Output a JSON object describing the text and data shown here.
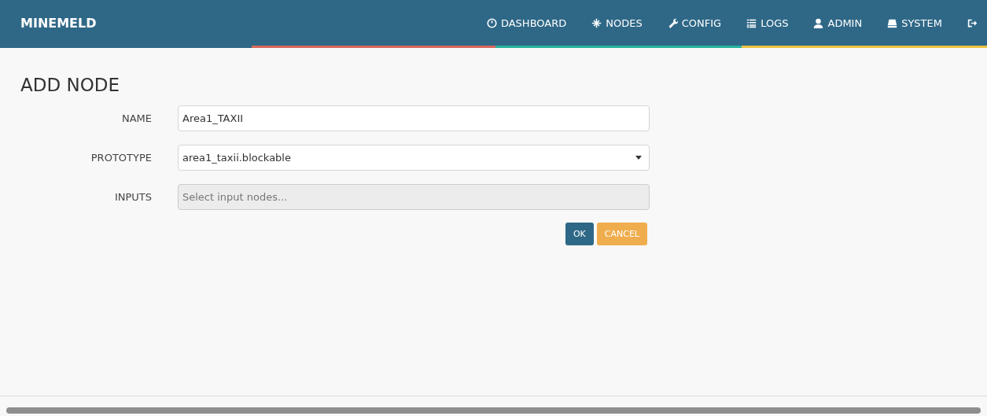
{
  "brand": "MINEMELD",
  "nav": [
    {
      "label": "DASHBOARD",
      "kind": "link"
    },
    {
      "label": "NODES",
      "kind": "link"
    },
    {
      "label": "CONFIG",
      "kind": "link"
    },
    {
      "label": "LOGS",
      "kind": "link"
    },
    {
      "label": "ADMIN",
      "kind": "link"
    },
    {
      "label": "SYSTEM",
      "kind": "link"
    },
    {
      "kind": "logout"
    }
  ],
  "title": "ADD NODE",
  "fields": [
    {
      "label": "NAME",
      "kind": "text",
      "value": "Area1_TAXII",
      "disabled": false
    },
    {
      "label": "PROTOTYPE",
      "kind": "select",
      "value": "area1_taxii.blockable",
      "disabled": false
    },
    {
      "label": "INPUTS",
      "kind": "text",
      "placeholder": "Select input nodes...",
      "disabled": true
    }
  ],
  "buttons": [
    {
      "label": "OK",
      "kind": "primary"
    },
    {
      "label": "CANCEL",
      "kind": "warning"
    }
  ]
}
